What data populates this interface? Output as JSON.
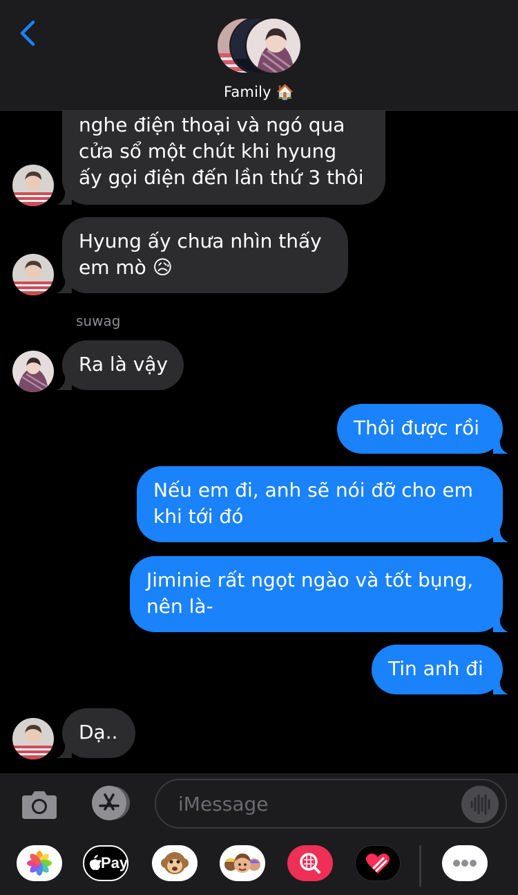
{
  "header": {
    "group_name": "Family 🏠"
  },
  "messages": {
    "m1": {
      "lines": [
        "nghe điện thoại và ngó qua",
        "cửa sổ một chút khi hyung",
        "ấy gọi điện đến lần thứ 3 thôi"
      ]
    },
    "m2": {
      "lines": [
        "Hyung ấy chưa nhìn thấy",
        "em mò 😥"
      ]
    },
    "sender_suwag": "suwag",
    "m3": {
      "text": "Ra là vậy"
    },
    "m4": {
      "text": "Thôi được rồi"
    },
    "m5": {
      "lines": [
        "Nếu em đi, anh sẽ nói đỡ cho em",
        "khi tới đó"
      ]
    },
    "m6": {
      "lines": [
        "Jiminie rất ngọt ngào và tốt bụng,",
        "nên là-"
      ]
    },
    "m7": {
      "text": "Tin anh đi"
    },
    "m8": {
      "text": "Dạ.."
    }
  },
  "composer": {
    "placeholder": "iMessage",
    "apple_pay_label": " Pay"
  },
  "icons": {
    "back": "chevron-left-icon",
    "camera": "camera-icon",
    "app_store": "app-store-icon",
    "audio": "audio-waveform-icon",
    "photos": "photos-app-icon",
    "apple_pay": "apple-pay-icon",
    "animoji": "monkey-animoji-icon",
    "memoji": "memoji-stickers-icon",
    "search": "image-search-icon",
    "digital_touch": "digital-touch-heart-icon",
    "more": "more-icon"
  },
  "colors": {
    "accent": "#1a82fb",
    "incoming": "#2c2c2e",
    "header_bg": "#1c1c1e"
  }
}
